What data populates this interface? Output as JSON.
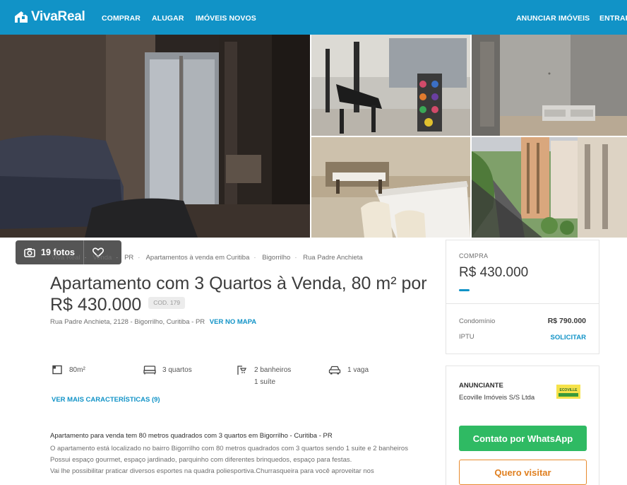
{
  "header": {
    "brand": "VivaReal",
    "nav_left": [
      "COMPRAR",
      "ALUGAR",
      "IMÓVEIS NOVOS"
    ],
    "nav_right": [
      "ANUNCIAR IMÓVEIS",
      "ENTRAR"
    ],
    "bg_color": "#1193c7"
  },
  "gallery": {
    "photo_count_label": "19 fotos",
    "camera_icon": "camera-icon",
    "favorite_icon": "heart-icon"
  },
  "breadcrumb": [
    "Viva Real",
    "Venda",
    "PR",
    "Apartamentos à venda em Curitiba",
    "Bigorrilho",
    "Rua Padre Anchieta"
  ],
  "listing": {
    "title": "Apartamento com 3 Quartos à Venda, 80 m² por R$ 430.000",
    "code": "COD. 179",
    "address": "Rua Padre Anchieta, 2128 - Bigorrilho, Curitiba - PR",
    "map_link": "VER NO MAPA"
  },
  "features": {
    "area": "80m²",
    "bedrooms": "3 quartos",
    "bathrooms": "2 banheiros",
    "suites": "1 suíte",
    "parking": "1 vaga",
    "more_link": "VER MAIS CARACTERÍSTICAS (9)"
  },
  "description": {
    "title": "Apartamento para venda tem 80 metros quadrados com 3 quartos em Bigorrilho - Curitiba - PR",
    "lines": [
      "O apartamento está localizado no bairro Bigorrilho com 80 metros quadrados com 3 quartos sendo 1 suite e 2 banheiros",
      "Possui espaço gourmet, espaço jardinado, parquinho com diferentes brinquedos, espaço para festas.",
      "Vai lhe possibilitar praticar diversos esportes na quadra poliesportiva.Churrasqueira para você aproveitar nos"
    ]
  },
  "price_card": {
    "label": "COMPRA",
    "price": "R$ 430.000",
    "condo_label": "Condomínio",
    "condo_value": "R$ 790.000",
    "iptu_label": "IPTU",
    "iptu_value": "SOLICITAR",
    "accent_color": "#1193c7"
  },
  "advertiser": {
    "label": "ANUNCIANTE",
    "name": "Ecoville Imóveis S/S Ltda",
    "logo_text": "ECOVILLE",
    "whatsapp_button": "Contato por WhatsApp",
    "visit_button": "Quero visitar",
    "whatsapp_color": "#2fba63",
    "visit_color": "#e07f1f"
  }
}
